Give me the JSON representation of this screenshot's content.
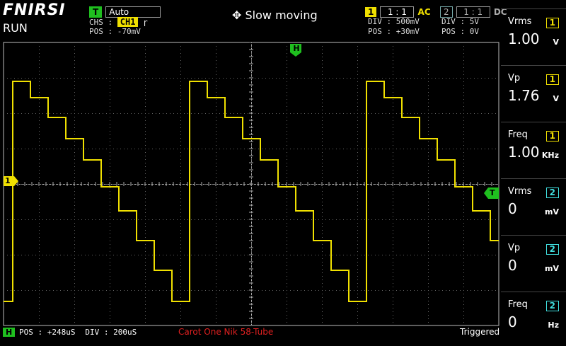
{
  "brand": "FNIRSI",
  "run_state": "RUN",
  "trigger": {
    "badge": "T",
    "mode": "Auto",
    "chs_label": "CHS :",
    "chs_value": "CH1",
    "edge_glyph": "ɼ",
    "pos": "POS : -70mV"
  },
  "center_status": {
    "icon": "move-icon",
    "text": "Slow moving"
  },
  "ch1": {
    "badge": "1",
    "probe": "1 : 1",
    "coupling": "AC",
    "div": "DIV :  500mV",
    "pos": "POS : +30mV"
  },
  "ch2": {
    "badge": "2",
    "probe": "1 : 1",
    "coupling": "DC",
    "div": "DIV :  5V",
    "pos": "POS : 0V"
  },
  "markers": {
    "horiz_trigger": "H",
    "ch1_level": "1",
    "trig_level": "T"
  },
  "measurements": [
    {
      "label": "Vrms",
      "channel": "1",
      "value": "1.00",
      "unit": "V"
    },
    {
      "label": "Vp",
      "channel": "1",
      "value": "1.76",
      "unit": "V"
    },
    {
      "label": "Freq",
      "channel": "1",
      "value": "1.00",
      "unit": "KHz"
    },
    {
      "label": "Vrms",
      "channel": "2",
      "value": "0",
      "unit": "mV"
    },
    {
      "label": "Vp",
      "channel": "2",
      "value": "0",
      "unit": "mV"
    },
    {
      "label": "Freq",
      "channel": "2",
      "value": "0",
      "unit": "Hz"
    }
  ],
  "bottom": {
    "h_badge": "H",
    "pos": "POS : +248uS",
    "div": "DIV : 200uS",
    "title": "Carot One Nik 58-Tube",
    "status": "Triggered"
  },
  "colors": {
    "ch1": "#f0e000",
    "ch2": "#40e0e0",
    "trigger": "#1fbf1f",
    "grid": "#808080",
    "title_red": "#e02020"
  }
}
